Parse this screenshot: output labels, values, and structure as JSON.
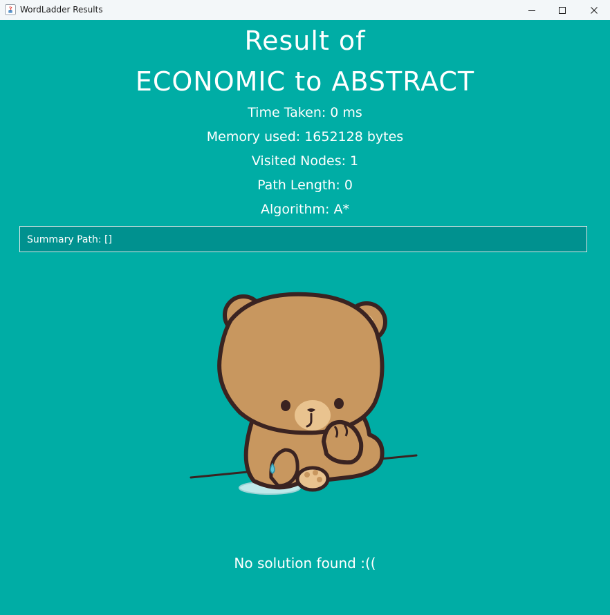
{
  "window": {
    "title": "WordLadder Results",
    "controls": {
      "minimize_icon": "minimize-icon",
      "maximize_icon": "maximize-icon",
      "close_icon": "close-icon"
    }
  },
  "result": {
    "heading_line1": "Result of",
    "heading_line2": "ECONOMIC to ABSTRACT",
    "time_taken": "Time Taken: 0 ms",
    "memory_used": "Memory used: 1652128 bytes",
    "visited_nodes": "Visited Nodes: 1",
    "path_length": "Path Length: 0",
    "algorithm": "Algorithm: A*",
    "summary_path": "Summary Path: []",
    "message": "No solution found :(("
  },
  "image": {
    "name": "sad-bear-illustration"
  },
  "colors": {
    "background": "#00ADA5",
    "summary_background": "#00918F",
    "text": "#FFFFFF",
    "titlebar": "#F3F7F9"
  }
}
